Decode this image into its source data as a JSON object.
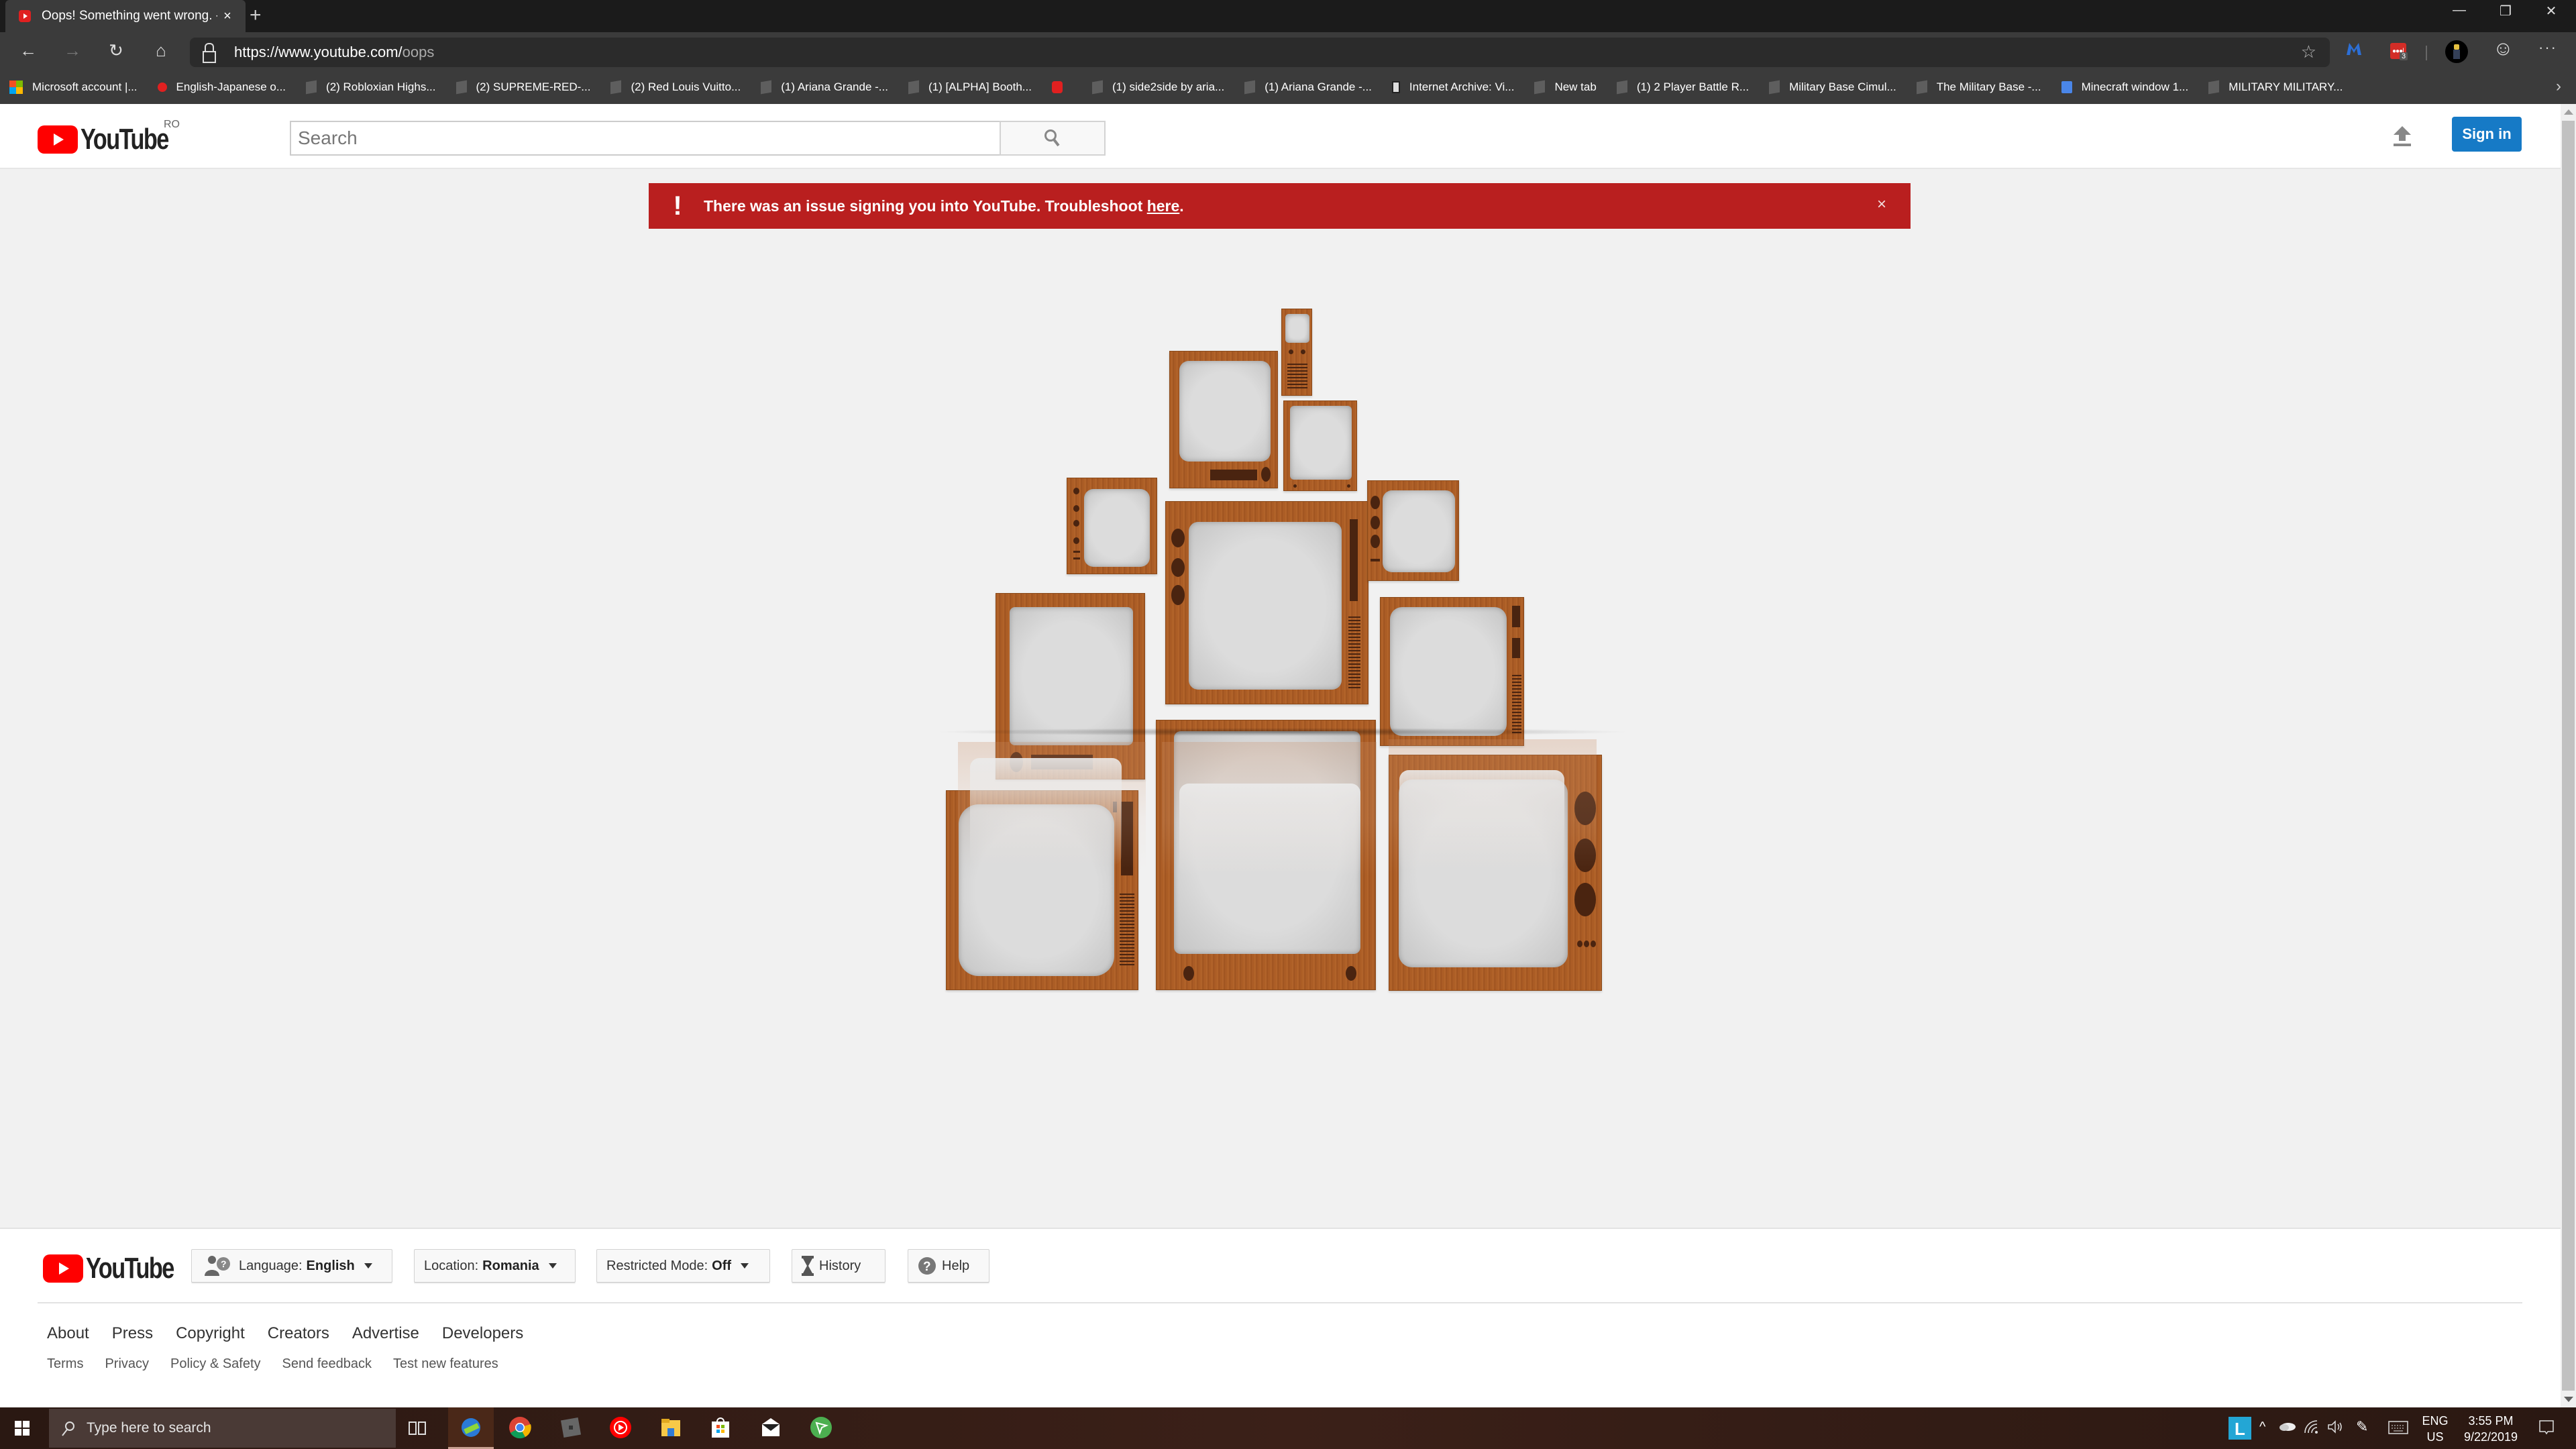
{
  "browser": {
    "tab_title": "Oops! Something went wrong. -",
    "tab_close": "×",
    "new_tab": "+",
    "url_host": "https://www.youtube.com/",
    "url_path": "oops",
    "window_controls": {
      "minimize": "—",
      "restore": "❐",
      "close": "✕"
    },
    "extension_badge": "3",
    "nav": {
      "back": "←",
      "forward": "→",
      "reload": "↻",
      "home": "⌂"
    },
    "star": "☆",
    "more": "···",
    "feedback": "☺",
    "bookmarks": [
      {
        "label": "Microsoft account |...",
        "icon": "ms"
      },
      {
        "label": "English-Japanese o...",
        "icon": "jp"
      },
      {
        "label": "(2) Robloxian Highs...",
        "icon": "roblox"
      },
      {
        "label": "(2) SUPREME-RED-...",
        "icon": "roblox"
      },
      {
        "label": "(2) Red Louis Vuitto...",
        "icon": "roblox"
      },
      {
        "label": "(1) Ariana Grande -...",
        "icon": "roblox"
      },
      {
        "label": "(1) [ALPHA] Booth...",
        "icon": "roblox"
      },
      {
        "label": "",
        "icon": "yt"
      },
      {
        "label": "(1) side2side by aria...",
        "icon": "roblox"
      },
      {
        "label": "(1) Ariana Grande -...",
        "icon": "roblox"
      },
      {
        "label": "Internet Archive: Vi...",
        "icon": "ia"
      },
      {
        "label": "New tab",
        "icon": "roblox"
      },
      {
        "label": "(1) 2 Player Battle R...",
        "icon": "roblox"
      },
      {
        "label": "Military Base Cimul...",
        "icon": "roblox"
      },
      {
        "label": "The Military Base -...",
        "icon": "roblox"
      },
      {
        "label": "Minecraft window 1...",
        "icon": "doc"
      },
      {
        "label": "MILITARY MILITARY...",
        "icon": "roblox"
      }
    ],
    "bookmarks_more": "›"
  },
  "header": {
    "logo_text": "YouTube",
    "region": "RO",
    "search_placeholder": "Search",
    "sign_in": "Sign in"
  },
  "banner": {
    "icon": "!",
    "text": "There was an issue signing you into YouTube. Troubleshoot ",
    "link": "here",
    "suffix": ".",
    "close": "×",
    "color": "#b91f1f"
  },
  "footer": {
    "logo_text": "YouTube",
    "language_label": "Language:",
    "language_value": "English",
    "location_label": "Location:",
    "location_value": "Romania",
    "restricted_label": "Restricted Mode:",
    "restricted_value": "Off",
    "history": "History",
    "help": "Help",
    "links_primary": [
      "About",
      "Press",
      "Copyright",
      "Creators",
      "Advertise",
      "Developers"
    ],
    "links_secondary": [
      "Terms",
      "Privacy",
      "Policy & Safety",
      "Send feedback",
      "Test new features"
    ]
  },
  "taskbar": {
    "search_placeholder": "Type here to search",
    "apps": [
      "task-view",
      "edge-dev",
      "chrome",
      "roblox",
      "youtube-music",
      "file-explorer",
      "store",
      "mail",
      "vpn"
    ],
    "tray": {
      "lang_top": "ENG",
      "lang_bottom": "US",
      "time": "3:55 PM",
      "date": "9/22/2019"
    }
  },
  "colors": {
    "accent_blue": "#167ac6",
    "youtube_red": "#ff0000",
    "page_bg": "#f1f1f1"
  }
}
